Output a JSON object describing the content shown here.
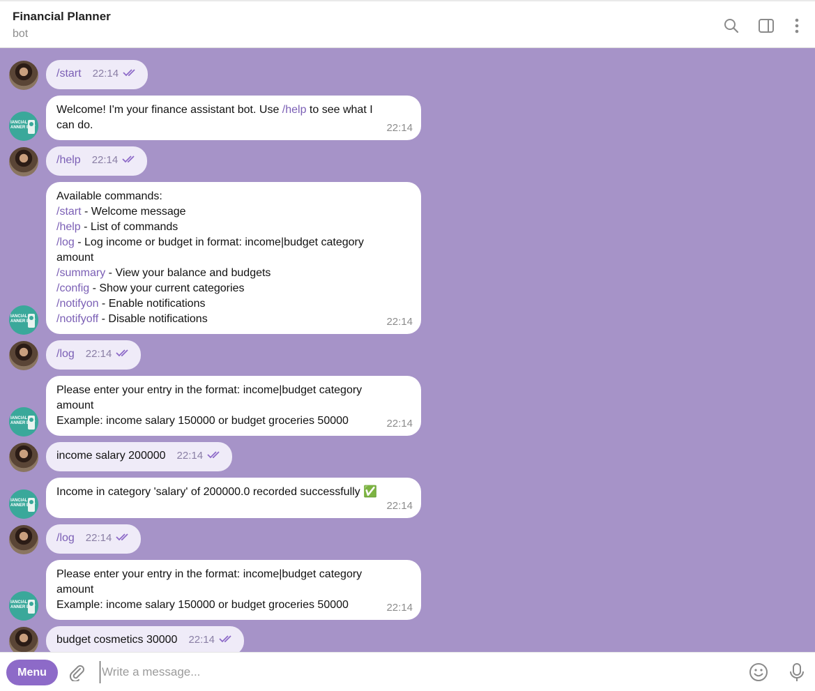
{
  "header": {
    "title": "Financial Planner",
    "subtitle": "bot"
  },
  "messages": [
    {
      "from": "user",
      "text": "/start",
      "time": "22:14"
    },
    {
      "from": "bot",
      "lines": [
        "Welcome! I'm your finance assistant bot. Use /help to see what I",
        "can do."
      ],
      "time": "22:14"
    },
    {
      "from": "user",
      "text": "/help",
      "time": "22:14"
    },
    {
      "from": "bot",
      "intro": "Available commands:",
      "commands": [
        {
          "cmd": "/start",
          "desc": " - Welcome message"
        },
        {
          "cmd": "/help",
          "desc": " - List of commands"
        },
        {
          "cmd": "/log",
          "desc": " - Log income or budget in format: income|budget category"
        },
        {
          "cmd": "",
          "desc": "amount"
        },
        {
          "cmd": "/summary",
          "desc": " - View your balance and budgets"
        },
        {
          "cmd": "/config",
          "desc": " - Show your current categories"
        },
        {
          "cmd": "/notifyon",
          "desc": " - Enable notifications"
        },
        {
          "cmd": "/notifyoff",
          "desc": " - Disable notifications"
        }
      ],
      "time": "22:14"
    },
    {
      "from": "user",
      "text": "/log",
      "time": "22:14"
    },
    {
      "from": "bot",
      "lines": [
        "Please enter your entry in the format: income|budget category",
        "amount",
        "Example: income salary 150000 or budget groceries 50000"
      ],
      "time": "22:14"
    },
    {
      "from": "user",
      "text": "income salary 200000",
      "time": "22:14"
    },
    {
      "from": "bot",
      "lines": [
        "Income in category 'salary' of 200000.0 recorded successfully ✅"
      ],
      "time": "22:14"
    },
    {
      "from": "user",
      "text": "/log",
      "time": "22:14"
    },
    {
      "from": "bot",
      "lines": [
        "Please enter your entry in the format: income|budget category",
        "amount",
        "Example: income salary 150000 or budget groceries 50000"
      ],
      "time": "22:14"
    },
    {
      "from": "user",
      "text": "budget cosmetics 30000",
      "time": "22:14"
    }
  ],
  "composer": {
    "menu_label": "Menu",
    "placeholder": "Write a message..."
  },
  "colors": {
    "chat_bg": "#a693c8",
    "accent": "#8d6ac8",
    "link": "#7b5fb5"
  },
  "icons": [
    "search-icon",
    "sidebar-toggle-icon",
    "more-vertical-icon",
    "paperclip-icon",
    "emoji-icon",
    "microphone-icon"
  ]
}
